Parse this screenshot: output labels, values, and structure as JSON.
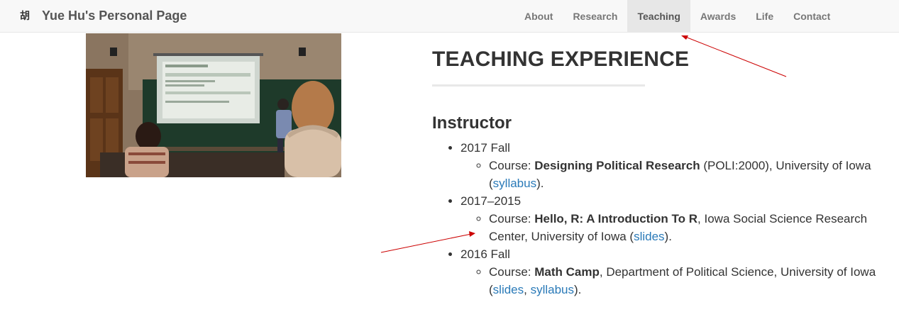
{
  "brand": {
    "logo_glyph": "胡",
    "name": "Yue Hu's Personal Page"
  },
  "nav": {
    "items": [
      {
        "label": "About"
      },
      {
        "label": "Research"
      },
      {
        "label": "Teaching",
        "active": true
      },
      {
        "label": "Awards"
      },
      {
        "label": "Life"
      },
      {
        "label": "Contact"
      }
    ]
  },
  "photo": {
    "slide_heading": "Attributes of an object"
  },
  "main": {
    "title": "TEACHING EXPERIENCE",
    "section": "Instructor",
    "entries": [
      {
        "year": "2017 Fall",
        "course_prefix": "Course: ",
        "course_name": "Designing Political Research",
        "details": " (POLI:2000), University of Iowa (",
        "links": [
          "syllabus"
        ],
        "suffix": ")."
      },
      {
        "year": "2017–2015",
        "course_prefix": "Course: ",
        "course_name": "Hello, R: A Introduction To R",
        "details": ", Iowa Social Science Research Center, University of Iowa (",
        "links": [
          "slides"
        ],
        "suffix": ")."
      },
      {
        "year": "2016 Fall",
        "course_prefix": "Course: ",
        "course_name": "Math Camp",
        "details": ", Department of Political Science, University of Iowa (",
        "links": [
          "slides",
          "syllabus"
        ],
        "link_sep": ", ",
        "suffix": ")."
      }
    ]
  },
  "colors": {
    "link": "#2a7ab8",
    "annotation_arrow": "#cc0000",
    "navbar_bg": "#f8f8f8",
    "nav_active_bg": "#e7e7e7"
  }
}
